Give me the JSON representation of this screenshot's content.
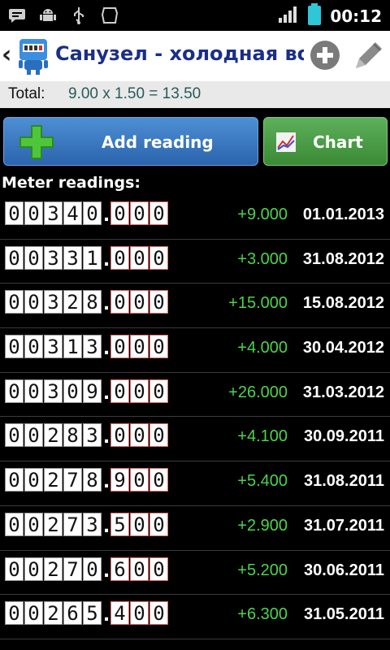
{
  "status_bar": {
    "time": "00:12",
    "icons": [
      "chat-icon",
      "android-debug-icon",
      "usb-icon",
      "blank-icon",
      "signal-icon",
      "battery-icon"
    ]
  },
  "header": {
    "title": "Санузел - холодная во",
    "back_icon": "back-chevron-icon",
    "logo": "app-logo-icon",
    "add_icon": "add-circle-icon",
    "edit_icon": "pencil-icon"
  },
  "total": {
    "label": "Total:",
    "value": "9.00 x 1.50 = 13.50"
  },
  "buttons": {
    "add_reading": "Add reading",
    "chart": "Chart"
  },
  "section_title": "Meter readings:",
  "colors": {
    "title": "#1b2e8a",
    "delta": "#4cd44c",
    "add_button": "#3a78c4",
    "chart_button": "#4a9c45"
  },
  "readings": [
    {
      "int": "00340",
      "frac": "000",
      "delta": "+9.000",
      "date": "01.01.2013"
    },
    {
      "int": "00331",
      "frac": "000",
      "delta": "+3.000",
      "date": "31.08.2012"
    },
    {
      "int": "00328",
      "frac": "000",
      "delta": "+15.000",
      "date": "15.08.2012"
    },
    {
      "int": "00313",
      "frac": "000",
      "delta": "+4.000",
      "date": "30.04.2012"
    },
    {
      "int": "00309",
      "frac": "000",
      "delta": "+26.000",
      "date": "31.03.2012"
    },
    {
      "int": "00283",
      "frac": "000",
      "delta": "+4.100",
      "date": "30.09.2011"
    },
    {
      "int": "00278",
      "frac": "900",
      "delta": "+5.400",
      "date": "31.08.2011"
    },
    {
      "int": "00273",
      "frac": "500",
      "delta": "+2.900",
      "date": "31.07.2011"
    },
    {
      "int": "00270",
      "frac": "600",
      "delta": "+5.200",
      "date": "30.06.2011"
    },
    {
      "int": "00265",
      "frac": "400",
      "delta": "+6.300",
      "date": "31.05.2011"
    }
  ]
}
